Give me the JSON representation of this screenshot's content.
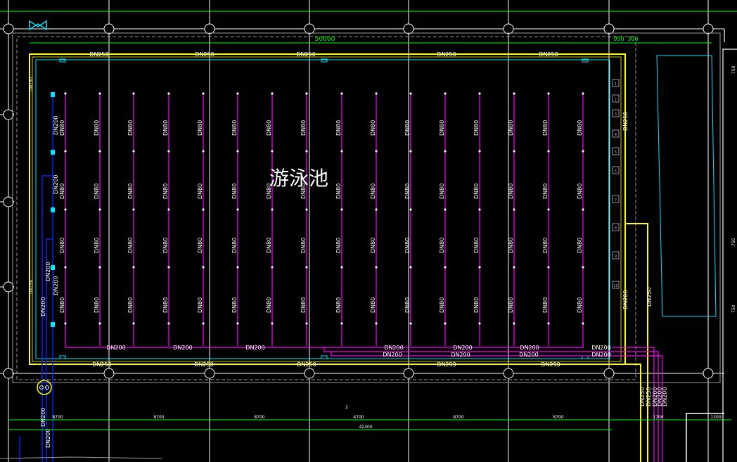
{
  "canvas": {
    "title": "游泳池",
    "top_dimension": "50000",
    "top_right_dims": [
      "950",
      "300"
    ],
    "bottom_total": "42300",
    "bottom_spans": [
      "8700",
      "8700",
      "8700",
      "4700",
      "8700",
      "8700"
    ],
    "bottom_right_dims": [
      "1700",
      "1300"
    ],
    "bottom_mid_label": "2",
    "pipe_labels": {
      "top_main": "DN250",
      "bottom_main": "DN250",
      "branch": "DN80",
      "collector": "DN200",
      "left_riser": "DN200",
      "left_side": "DN150",
      "right_main_upper": "DN250",
      "right_main_lower": "DN200",
      "yellow_right": "DN250",
      "bottom_down": [
        "DN250",
        "DN250",
        "DN200",
        "DN200",
        "DN200"
      ]
    },
    "grid_marker_right": [
      "1",
      "2",
      "3",
      "4",
      "5",
      "6",
      "7",
      "8",
      "9",
      "10"
    ],
    "right_edge_dims": [
      "750",
      "750",
      "750"
    ],
    "pump_label": "泵"
  },
  "colors": {
    "background": "#000000",
    "grid_white": "#ffffff",
    "dimension_green": "#00ff00",
    "pipe_yellow": "#ffff00",
    "pipe_magenta": "#ff00ff",
    "pipe_cyan": "#00e5ff",
    "pipe_blue": "#0022ff",
    "outline_gray": "#9a9a9a"
  }
}
